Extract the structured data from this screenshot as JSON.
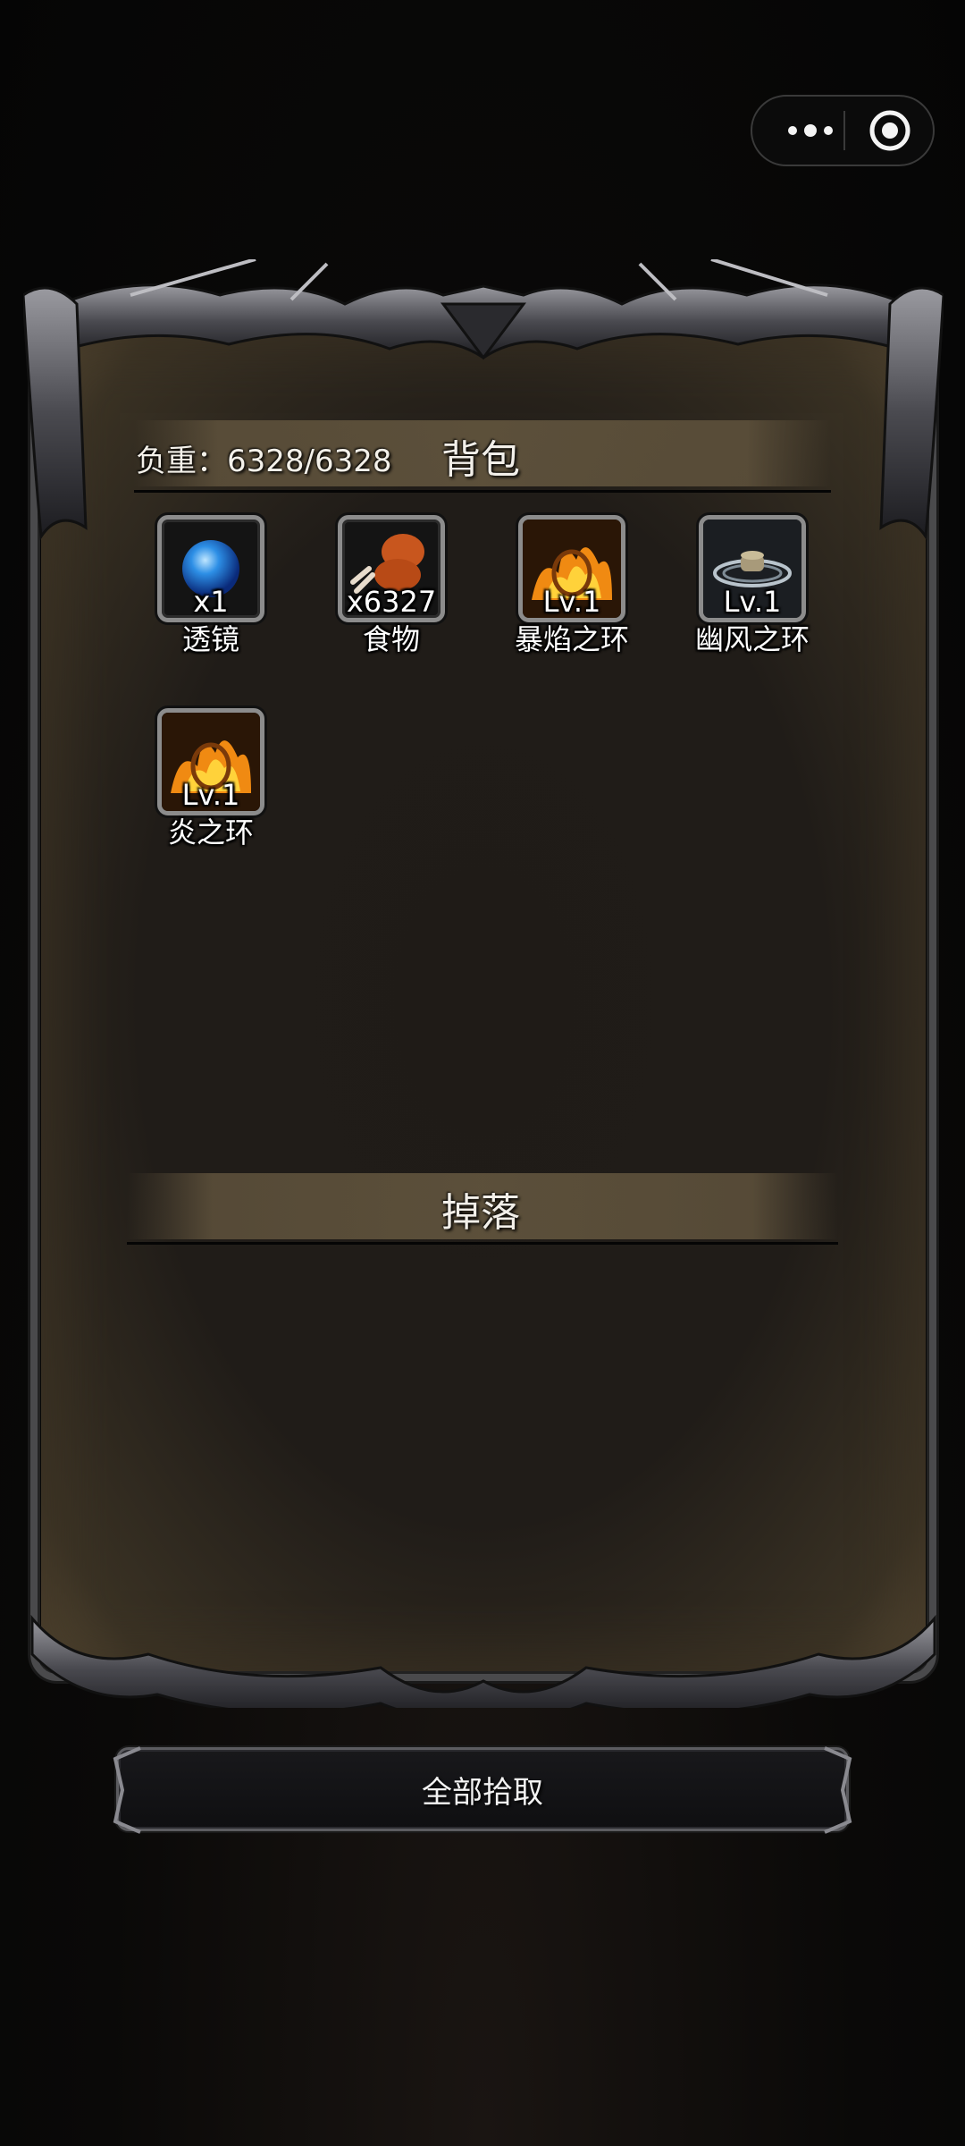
{
  "capsule": {
    "menu_icon": "more-dots-icon",
    "close_icon": "target-circle-icon"
  },
  "backpack": {
    "title": "背包",
    "weight_label": "负重：6328/6328",
    "items": [
      {
        "qty": "x1",
        "name": "透镜",
        "icon": "blue-orb-icon"
      },
      {
        "qty": "x6327",
        "name": "食物",
        "icon": "meat-drumstick-icon"
      },
      {
        "qty": "Lv.1",
        "name": "暴焰之环",
        "icon": "flame-ring-icon"
      },
      {
        "qty": "Lv.1",
        "name": "幽风之环",
        "icon": "wind-ring-icon"
      },
      {
        "qty": "Lv.1",
        "name": "炎之环",
        "icon": "flame-ring-icon"
      }
    ]
  },
  "drops": {
    "title": "掉落",
    "items": []
  },
  "actions": {
    "pick_all": "全部拾取"
  },
  "colors": {
    "panel": "#201c18",
    "band": "#5f523c",
    "border": "#4a4a4c",
    "text": "#f2efe9"
  }
}
